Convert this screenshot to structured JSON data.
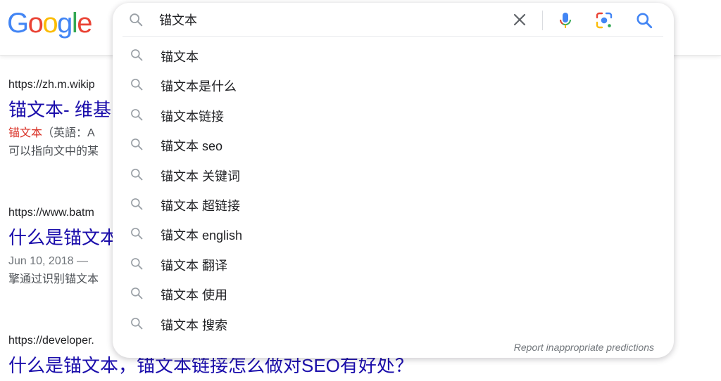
{
  "logo": {
    "letters": [
      "G",
      "o",
      "o",
      "g",
      "l",
      "e"
    ]
  },
  "search": {
    "query": "锚文本",
    "clear_icon": "close-icon",
    "mic_icon": "microphone-icon",
    "lens_icon": "camera-lens-icon",
    "search_icon": "search-icon"
  },
  "suggestions": [
    "锚文本",
    "锚文本是什么",
    "锚文本链接",
    "锚文本 seo",
    "锚文本 关键词",
    "锚文本 超链接",
    "锚文本 english",
    "锚文本 翻译",
    "锚文本 使用",
    "锚文本 搜索"
  ],
  "report_label": "Report inappropriate predictions",
  "results": [
    {
      "url": "https://zh.m.wikip",
      "title": "锚文本- 维基",
      "snippet_em": "锚文本",
      "snippet_rest": "（英語：A",
      "snippet_line2": "可以指向文中的某"
    },
    {
      "url": "https://www.batm",
      "title": "什么是锚文本",
      "snippet_line1": "Jun 10, 2018 — ",
      "snippet_line2": "擎通过识别锚文本"
    },
    {
      "url": "https://developer.",
      "title": "什么是锚文本，锚文本链接怎么做对SEO有好处？"
    }
  ],
  "colors": {
    "link": "#1a0dab",
    "highlight": "#d93025",
    "google_blue": "#4285f4",
    "google_red": "#ea4335",
    "google_yellow": "#fbbc05",
    "google_green": "#34a853"
  }
}
